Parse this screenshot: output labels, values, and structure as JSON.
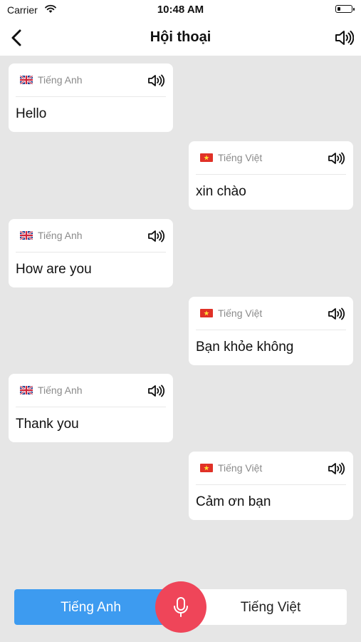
{
  "status_bar": {
    "carrier": "Carrier",
    "time": "10:48 AM"
  },
  "header": {
    "title": "Hội thoại"
  },
  "messages": [
    {
      "side": "left",
      "lang": "Tiếng Anh",
      "flag": "uk-flag",
      "text": "Hello"
    },
    {
      "side": "right",
      "lang": "Tiếng Việt",
      "flag": "vn-flag",
      "text": "xin chào"
    },
    {
      "side": "left",
      "lang": "Tiếng Anh",
      "flag": "uk-flag",
      "text": "How are you"
    },
    {
      "side": "right",
      "lang": "Tiếng Việt",
      "flag": "vn-flag",
      "text": "Bạn khỏe không"
    },
    {
      "side": "left",
      "lang": "Tiếng Anh",
      "flag": "uk-flag",
      "text": "Thank you"
    },
    {
      "side": "right",
      "lang": "Tiếng Việt",
      "flag": "vn-flag",
      "text": "Cảm ơn bạn"
    }
  ],
  "language_toggle": {
    "left_label": "Tiếng Anh",
    "right_label": "Tiếng Việt"
  },
  "colors": {
    "active": "#3d9bf0",
    "mic": "#ef4559",
    "background": "#e6e6e6"
  }
}
